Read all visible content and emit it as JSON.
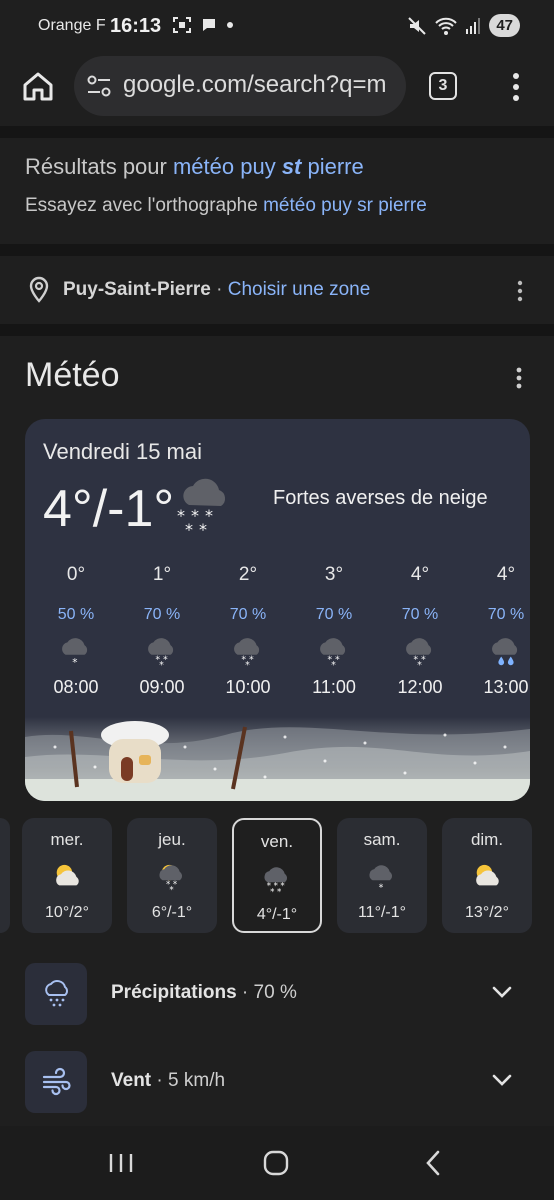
{
  "status": {
    "carrier": "Orange F",
    "time": "16:13",
    "battery": "47"
  },
  "browser": {
    "url": "google.com/search?q=m",
    "tab_count": "3"
  },
  "spelling": {
    "results_prefix": "Résultats pour ",
    "results_query_a": "météo puy ",
    "results_query_b": "st",
    "results_query_c": " pierre",
    "try_prefix": "Essayez avec l'orthographe ",
    "try_query": "météo puy sr pierre"
  },
  "location": {
    "name": "Puy-Saint-Pierre",
    "separator": " · ",
    "choose": "Choisir une zone"
  },
  "weather": {
    "title": "Météo",
    "date": "Vendredi 15 mai",
    "temp": "4°/-1°",
    "condition": "Fortes averses de neige",
    "hourly": [
      {
        "temp": "0°",
        "precip": "50 %",
        "icon": "cloud-snow-light-icon",
        "time": "08:00"
      },
      {
        "temp": "1°",
        "precip": "70 %",
        "icon": "cloud-snow-icon",
        "time": "09:00"
      },
      {
        "temp": "2°",
        "precip": "70 %",
        "icon": "cloud-snow-icon",
        "time": "10:00"
      },
      {
        "temp": "3°",
        "precip": "70 %",
        "icon": "cloud-snow-icon",
        "time": "11:00"
      },
      {
        "temp": "4°",
        "precip": "70 %",
        "icon": "cloud-snow-icon",
        "time": "12:00"
      },
      {
        "temp": "4°",
        "precip": "70 %",
        "icon": "cloud-rain-icon",
        "time": "13:00"
      }
    ],
    "daily": [
      {
        "name": "mer.",
        "temp": "10°/2°",
        "icon": "sun-cloud-icon"
      },
      {
        "name": "jeu.",
        "temp": "6°/-1°",
        "icon": "sun-cloud-snow-icon"
      },
      {
        "name": "ven.",
        "temp": "4°/-1°",
        "icon": "cloud-heavy-snow-icon",
        "selected": true
      },
      {
        "name": "sam.",
        "temp": "11°/-1°",
        "icon": "cloud-snow-light-icon"
      },
      {
        "name": "dim.",
        "temp": "13°/2°",
        "icon": "sun-cloud-icon"
      }
    ],
    "precipitation": {
      "label": "Précipitations",
      "separator": " · ",
      "value": "70 %"
    },
    "wind": {
      "label": "Vent",
      "separator": " · ",
      "value": "5 km/h"
    }
  },
  "colors": {
    "link": "#8ab4f8",
    "card": "#2e3241",
    "background": "#1f1f1f"
  }
}
